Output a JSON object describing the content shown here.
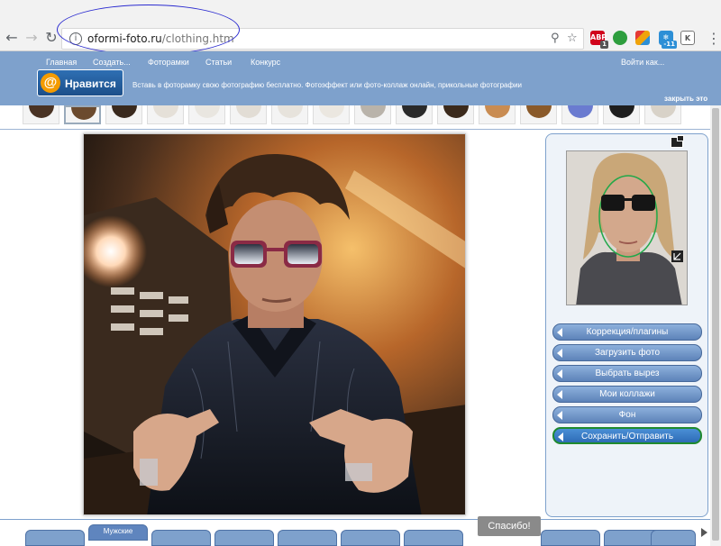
{
  "browser": {
    "url_host": "oformi-foto.ru",
    "url_path": "/clothing.htm",
    "extensions": [
      {
        "name": "abp-icon",
        "label": "ABP",
        "color": "#d0021b",
        "badge": "1"
      },
      {
        "name": "green-extension-icon",
        "label": "",
        "color": "#2e9e3e",
        "badge": ""
      },
      {
        "name": "colorful-extension-icon",
        "label": "",
        "color": "#f0a30a",
        "badge": ""
      },
      {
        "name": "weather-extension-icon",
        "label": "",
        "color": "#2d8fd6",
        "badge": "-11"
      },
      {
        "name": "k-extension-icon",
        "label": "K",
        "color": "#777777",
        "badge": ""
      }
    ]
  },
  "site": {
    "nav": [
      "Главная",
      "Создать...",
      "Фоторамки",
      "Статьи",
      "Конкурс"
    ],
    "login": "Войти как...",
    "like_button": "Нравится",
    "tagline": "Вставь в фоторамку свою фотографию бесплатно. Фотоэффект или фото-коллаж онлайн, прикольные фотографии",
    "close_link": "закрыть это"
  },
  "menu": [
    "Коррекция/плагины",
    "Загрузить фото",
    "Выбрать вырез",
    "Мои коллажи",
    "Фон",
    "Сохранить/Отправить"
  ],
  "bottom": {
    "active_tab": "Мужские",
    "thanks_button": "Спасибо!"
  },
  "colors": {
    "header_blue": "#7ea1cc",
    "save_border": "#1f8a2e"
  }
}
